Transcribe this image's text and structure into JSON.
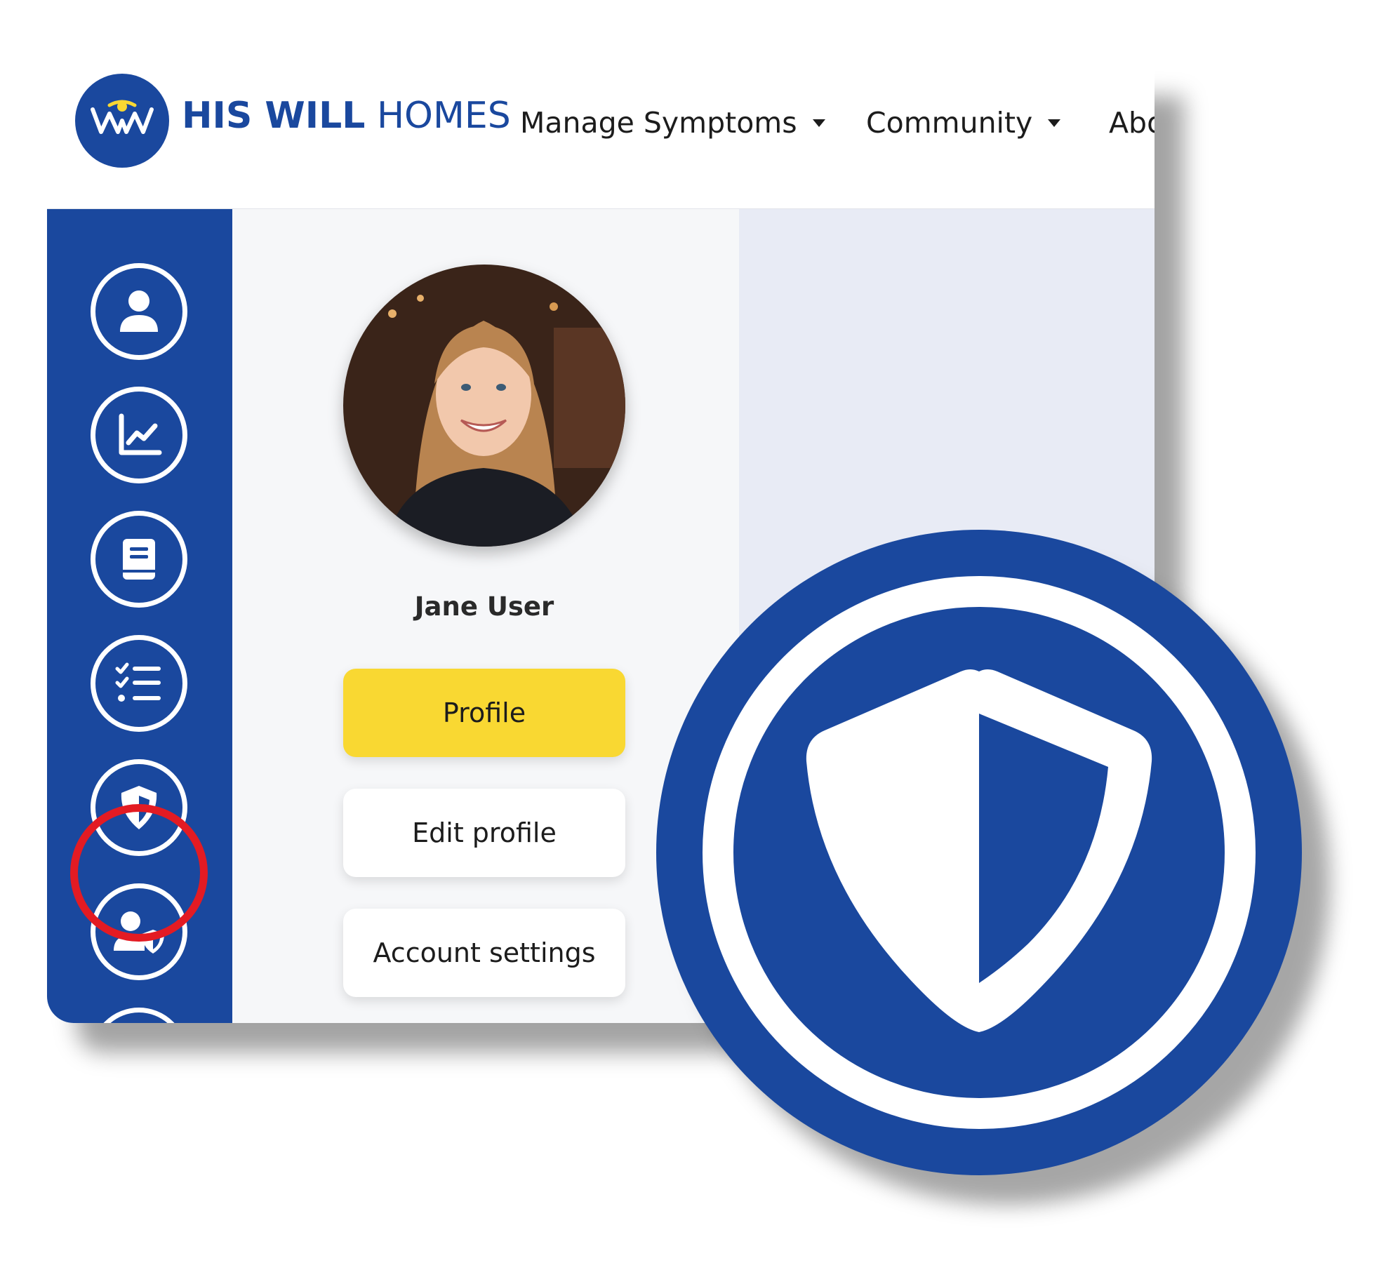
{
  "header": {
    "brand_bold": "HIS WILL",
    "brand_light": "HOMES",
    "nav": [
      {
        "label": "Manage Symptoms",
        "has_dropdown": true
      },
      {
        "label": "Community",
        "has_dropdown": true
      },
      {
        "label": "Abo",
        "has_dropdown": false
      }
    ]
  },
  "sidebar": {
    "items": [
      {
        "icon": "user-icon"
      },
      {
        "icon": "chart-line-icon"
      },
      {
        "icon": "book-icon"
      },
      {
        "icon": "checklist-icon"
      },
      {
        "icon": "shield-icon",
        "highlighted": true
      },
      {
        "icon": "user-shield-icon"
      }
    ]
  },
  "profile": {
    "name": "Jane User",
    "buttons": [
      {
        "label": "Profile",
        "active": true
      },
      {
        "label": "Edit profile",
        "active": false
      },
      {
        "label": "Account settings",
        "active": false
      }
    ]
  },
  "colors": {
    "brand_blue": "#1a489e",
    "active_yellow": "#f9d832",
    "highlight_red": "#e31b23",
    "panel_bg": "#f6f7f9",
    "right_bg": "#e8ebf5"
  },
  "zoom_icon": "shield-icon"
}
